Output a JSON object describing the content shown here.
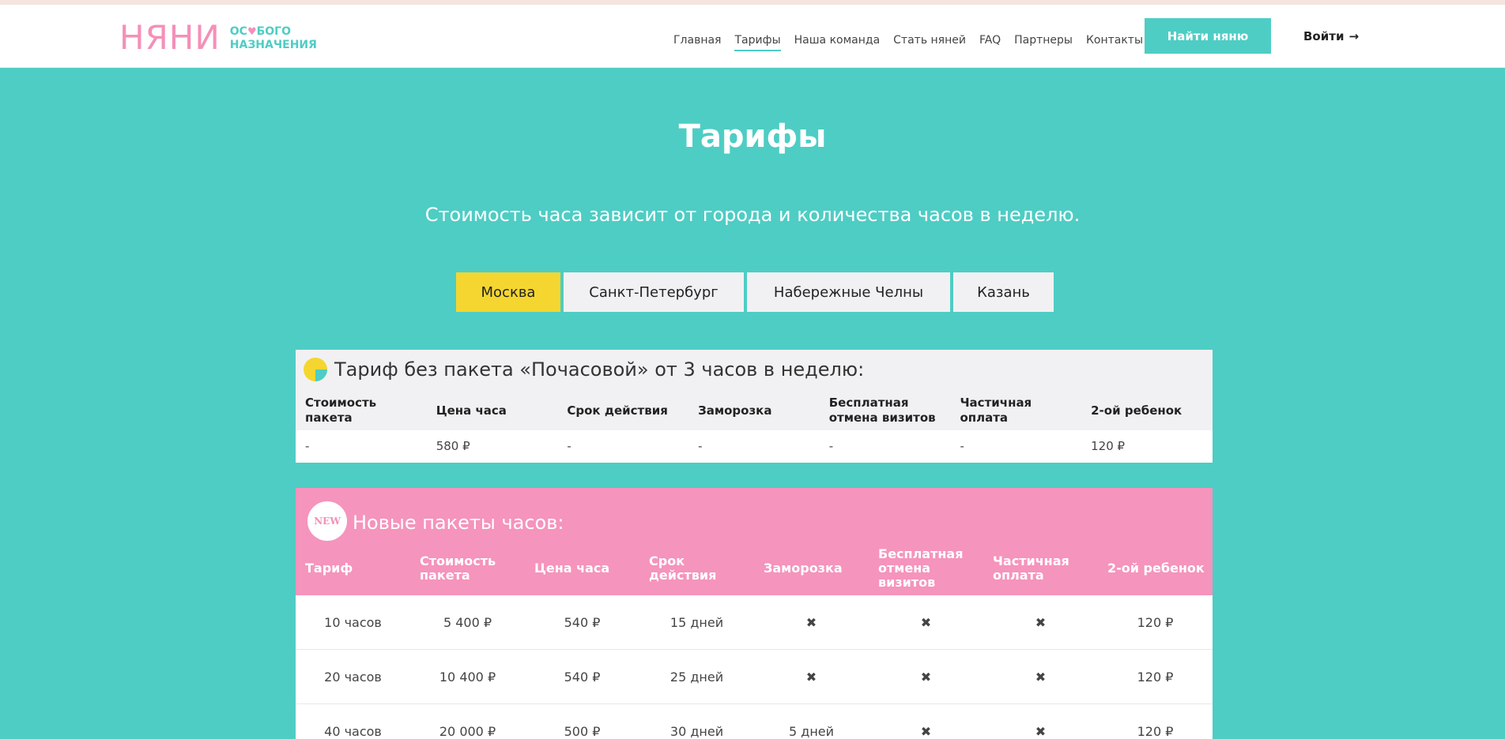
{
  "header": {
    "logo_main": "НЯНИ",
    "logo_sub_line1_a": "ОС",
    "logo_sub_line1_b": "БОГО",
    "logo_sub_line2": "НАЗНАЧЕНИЯ",
    "nav": [
      "Главная",
      "Тарифы",
      "Наша команда",
      "Стать няней",
      "FAQ",
      "Партнеры",
      "Контакты"
    ],
    "active_nav_index": 1,
    "find_button": "Найти няню",
    "login": "Войти",
    "login_arrow": "→"
  },
  "main": {
    "title": "Тарифы",
    "subtitle": "Стоимость часа зависит от города и количества часов в неделю.",
    "cities": [
      "Москва",
      "Санкт-Петербург",
      "Набережные Челны",
      "Казань"
    ],
    "active_city_index": 0
  },
  "hourly": {
    "title": "Тариф без пакета «Почасовой» от 3 часов в неделю:",
    "columns": [
      "Стоимость пакета",
      "Цена часа",
      "Срок действия",
      "Заморозка",
      "Бесплатная отмена визитов",
      "Частичная оплата",
      "2-ой ребенок"
    ],
    "values": [
      "-",
      "580 ₽",
      "-",
      "-",
      "-",
      "-",
      "120 ₽"
    ]
  },
  "packages": {
    "badge": "NEW",
    "title": "Новые пакеты часов:",
    "columns": [
      "Тариф",
      "Стоимость пакета",
      "Цена часа",
      "Срок действия",
      "Заморозка",
      "Бесплатная отмена визитов",
      "Частичная оплата",
      "2-ой ребенок"
    ],
    "rows": [
      [
        "10 часов",
        "5 400 ₽",
        "540 ₽",
        "15 дней",
        "✖",
        "✖",
        "✖",
        "120 ₽"
      ],
      [
        "20 часов",
        "10 400 ₽",
        "540 ₽",
        "25 дней",
        "✖",
        "✖",
        "✖",
        "120 ₽"
      ],
      [
        "40 часов",
        "20 000 ₽",
        "500 ₽",
        "30 дней",
        "5 дней",
        "✖",
        "✖",
        "120 ₽"
      ]
    ]
  },
  "colors": {
    "teal": "#4ecdc4",
    "pink": "#f594bd",
    "yellow": "#f5d630"
  }
}
